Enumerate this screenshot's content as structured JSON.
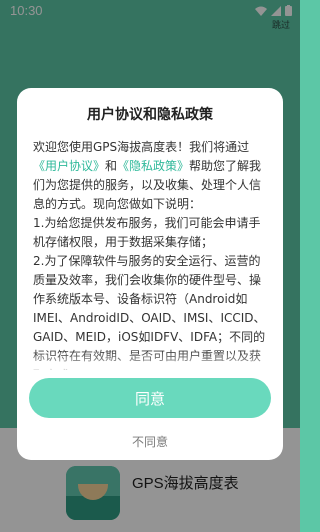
{
  "status_bar": {
    "time": "10:30",
    "skip_label": "跳过"
  },
  "app": {
    "name": "GPS海拔高度表"
  },
  "dialog": {
    "title": "用户协议和隐私政策",
    "body": {
      "intro": "欢迎您使用GPS海拔高度表！我们将通过",
      "user_agreement_link": "《用户协议》",
      "and": "和",
      "privacy_policy_link": "《隐私政策》",
      "intro_rest": "帮助您了解我们为您提供的服务，以及收集、处理个人信息的方式。现向您做如下说明：",
      "item1": "1.为给您提供发布服务，我们可能会申请手机存储权限，用于数据采集存储；",
      "item2": "2.为了保障软件与服务的安全运行、运营的质量及效率，我们会收集你的硬件型号、操作系统版本号、设备标识符（Android如IMEI、AndroidID、OAID、IMSI、ICCID、GAID、MEID，iOS如IDFV、IDFA；不同的标识符在有效期、是否可由用户重置以及获取方式"
    },
    "agree_label": "同意",
    "disagree_label": "不同意"
  },
  "colors": {
    "accent": "#2fb99a",
    "button": "#69d9bd",
    "background": "#5cc7a6"
  }
}
